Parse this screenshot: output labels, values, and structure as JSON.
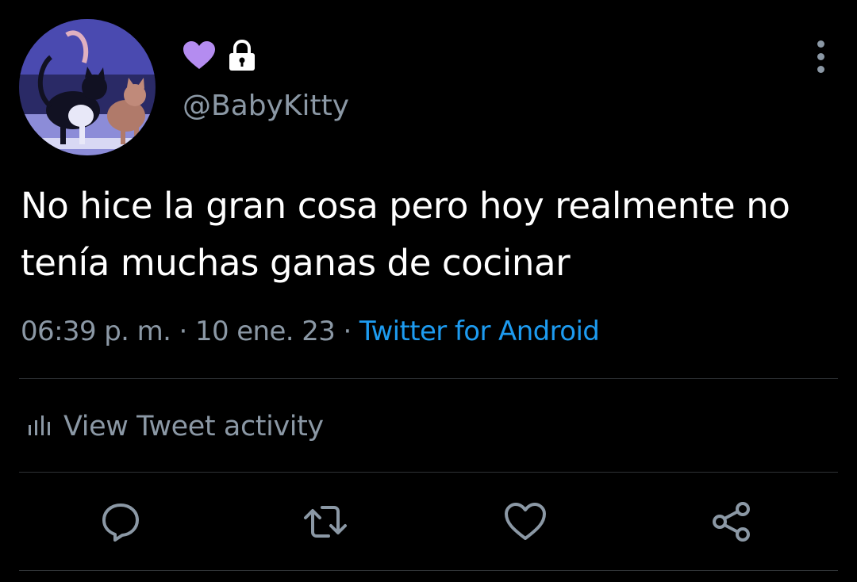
{
  "user": {
    "handle": "@BabyKitty",
    "name_icons": [
      "purple-heart-icon",
      "lock-icon"
    ],
    "avatar": "cats-avatar"
  },
  "tweet": {
    "text": "No hice la gran cosa pero hoy realmente no tenía muchas ganas de cocinar",
    "time": "06:39 p. m.",
    "separator": " · ",
    "date": "10 ene. 23",
    "source": "Twitter for Android"
  },
  "activity": {
    "label": "View Tweet activity",
    "icon": "bar-chart-icon"
  },
  "actions": [
    "reply-icon",
    "retweet-icon",
    "like-icon",
    "share-icon"
  ],
  "colors": {
    "background": "#000000",
    "text": "#ffffff",
    "secondary_text": "#8b98a5",
    "link": "#1d9bf0",
    "divider": "#2f3336",
    "heart": "#b48cf0"
  }
}
